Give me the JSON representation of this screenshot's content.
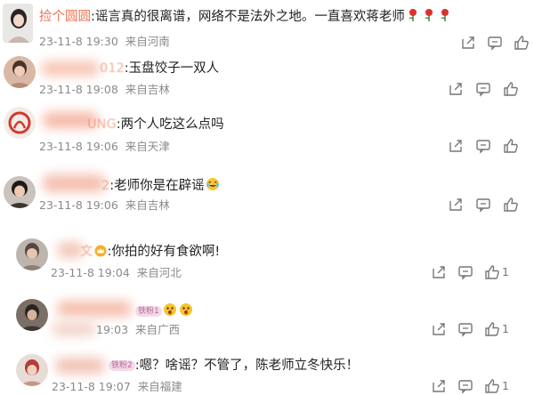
{
  "comments": [
    {
      "username": "捡个圆圆",
      "text": ":谣言真的很离谱，网络不是法外之地。一直喜欢蒋老师",
      "time": "23-11-8 19:30",
      "location": "来自河南",
      "icons": [
        "share-icon",
        "comment-icon",
        "like-icon"
      ],
      "emoji": [
        "rose-emoji",
        "rose-emoji",
        "rose-emoji"
      ]
    },
    {
      "username": "012",
      "text": ":玉盘饺子一双人",
      "time": "23-11-8 19:08",
      "location": "来自吉林",
      "icons": [
        "share-icon",
        "comment-icon",
        "like-icon"
      ]
    },
    {
      "username": "UNG",
      "text": ":两个人吃这么点吗",
      "time": "23-11-8 19:06",
      "location": "来自天津",
      "icons": [
        "share-icon",
        "comment-icon",
        "like-icon"
      ]
    },
    {
      "username": "2",
      "text": ":老师你是在辟谣",
      "time": "23-11-8 19:06",
      "location": "来自吉林",
      "icons": [
        "share-icon",
        "comment-icon",
        "like-icon"
      ],
      "emoji": [
        "laugh-cry-emoji"
      ]
    },
    {
      "username": "文",
      "text": ":你拍的好有食欲啊!",
      "time": "23-11-8 19:04",
      "location": "来自河北",
      "likes": "1",
      "icons": [
        "share-icon",
        "comment-icon",
        "like-icon"
      ]
    },
    {
      "username": "",
      "badge": "铁粉1",
      "text": "",
      "time": "19:03",
      "location": "来自广西",
      "likes": "1",
      "icons": [
        "share-icon",
        "comment-icon",
        "like-icon"
      ],
      "emoji": [
        "surprised-emoji",
        "surprised-emoji"
      ]
    },
    {
      "username": "",
      "badge": "铁粉2",
      "text": ":嗯？啥谣？不管了，陈老师立冬快乐！",
      "time": "23-11-8 19:07",
      "location": "来自福建",
      "likes": "1",
      "icons": [
        "share-icon",
        "comment-icon",
        "like-icon"
      ]
    }
  ]
}
